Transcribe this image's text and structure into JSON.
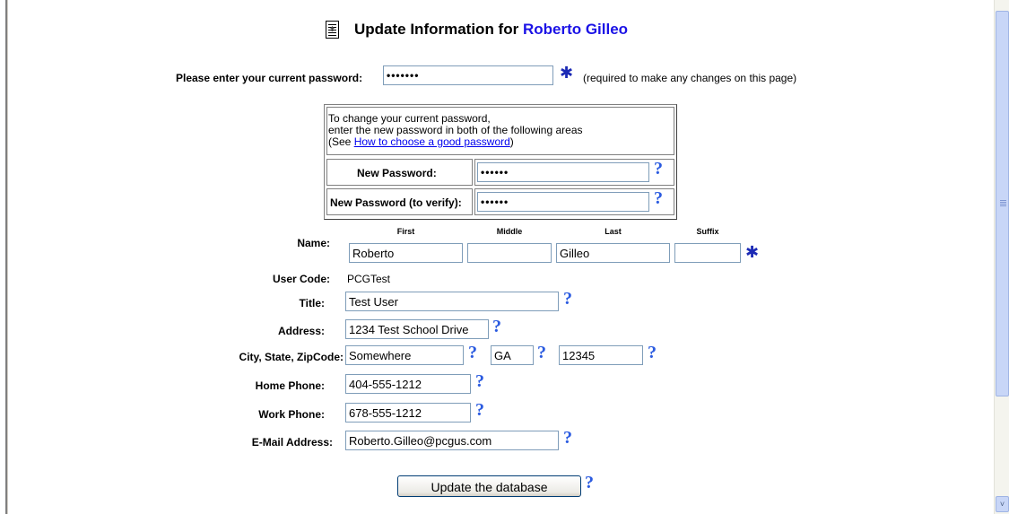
{
  "title": {
    "prefix": "Update Information for ",
    "user_name": "Roberto Gilleo"
  },
  "current_password": {
    "label": "Please enter your current password:",
    "value": "•••••••",
    "required_note": "(required to make any changes on this page)"
  },
  "password_change": {
    "intro_line1": "To change your current password,",
    "intro_line2": "enter the new password in both of the following areas",
    "see_prefix": "(See ",
    "link_text": "How to choose a good password",
    "see_suffix": ")",
    "new_label": "New Password:",
    "new_value": "••••••",
    "verify_label": "New Password (to verify):",
    "verify_value": "••••••"
  },
  "name": {
    "label": "Name:",
    "headers": {
      "first": "First",
      "middle": "Middle",
      "last": "Last",
      "suffix": "Suffix"
    },
    "first": "Roberto",
    "middle": "",
    "last": "Gilleo",
    "suffix": ""
  },
  "user_code": {
    "label": "User Code:",
    "value": "PCGTest"
  },
  "title_field": {
    "label": "Title:",
    "value": "Test User"
  },
  "address": {
    "label": "Address:",
    "value": "1234 Test School Drive"
  },
  "city_state_zip": {
    "label": "City, State, ZipCode:",
    "city": "Somewhere",
    "state": "GA",
    "zip": "12345"
  },
  "home_phone": {
    "label": "Home Phone:",
    "value": "404-555-1212"
  },
  "work_phone": {
    "label": "Work Phone:",
    "value": "678-555-1212"
  },
  "email": {
    "label": "E-Mail Address:",
    "value": "Roberto.Gilleo@pcgus.com"
  },
  "submit": {
    "label": "Update the database"
  },
  "icons": {
    "help": "?",
    "required": "✱",
    "scroll_down": "˅"
  },
  "colors": {
    "name_accent": "#1b12e6",
    "help_icon": "#2b5be0",
    "link": "#0000ee"
  }
}
